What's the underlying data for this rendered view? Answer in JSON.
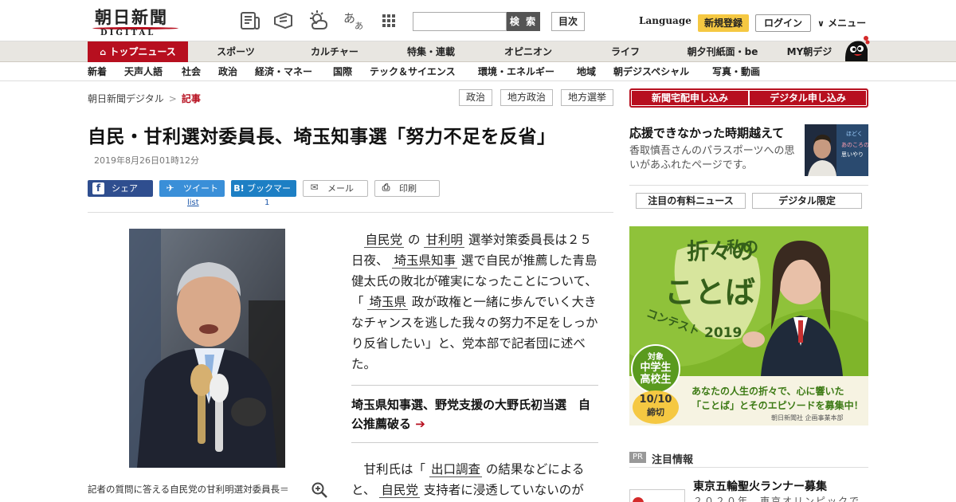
{
  "header": {
    "logo_jp": "朝日新聞",
    "logo_en": "DIGITAL",
    "search_button": "検 索",
    "toc_button": "目次",
    "language": "Language",
    "signup": "新規登録",
    "login": "ログイン",
    "menu": "メニュー"
  },
  "main_nav": [
    "トップニュース",
    "スポーツ",
    "カルチャー",
    "特集・連載",
    "オピニオン",
    "ライフ",
    "朝夕刊紙面・be",
    "MY朝デジ"
  ],
  "sub_nav": [
    "新着",
    "天声人語",
    "社会",
    "政治",
    "経済・マネー",
    "国際",
    "テック＆サイエンス",
    "環境・エネルギー",
    "地域",
    "朝デジスペシャル",
    "写真・動画"
  ],
  "breadcrumb": {
    "home": "朝日新聞デジタル",
    "sep": ">",
    "current": "記事"
  },
  "tags": [
    "政治",
    "地方政治",
    "地方選挙"
  ],
  "article": {
    "headline": "自民・甘利選対委員長、埼玉知事選「努力不足を反省」",
    "date": "2019年8月26日01時12分",
    "share": {
      "facebook": "シェア",
      "twitter": "ツイート",
      "twitter_count": "list",
      "hatena": "ブックマーク",
      "hatena_count": "1",
      "mail": "メール",
      "print": "印刷"
    },
    "caption": "記者の質問に答える自民党の甘利明選対委員長＝",
    "p1": {
      "a": "自民党",
      "b": " の ",
      "c": "甘利明",
      "d": " 選挙対策委員長は２５日夜、 ",
      "e": "埼玉県知事",
      "f": " 選で自民が推薦した青島健太氏の敗北が確実になったことについて、「 ",
      "g": "埼玉県",
      "h": " 政が政権と一緒に歩んでいく大きなチャンスを逃した我々の努力不足をしっかり反省したい」と、党本部で記者団に述べた。"
    },
    "related": "埼玉県知事選、野党支援の大野氏初当選　自公推薦破る",
    "related_arrow": "➔",
    "p2": {
      "a": "甘利氏は「 ",
      "b": "出口調査",
      "c": " の結果などによると、 ",
      "d": "自民党",
      "e": " 支持者に浸透していないのが"
    }
  },
  "sidebar": {
    "subscribe_paper": "新聞宅配申し込み",
    "subscribe_digital": "デジタル申し込み",
    "promo_title": "応援できなかった時期越えて",
    "promo_text": "香取慎吾さんのパラスポーツへの思いがあふれたページです。",
    "tabs": [
      "注目の有料ニュース",
      "デジタル限定"
    ],
    "ad": {
      "watashi": "私の",
      "oriori": "折々の",
      "kotoba": "ことば",
      "contest": "コンテスト",
      "year": "2019",
      "target_label": "対象",
      "target1": "中学生",
      "target2": "高校生",
      "deadline1": "10/10",
      "deadline2": "締切",
      "tagline1": "あなたの人生の折々で、心に響いた",
      "tagline2": "「ことば」とそのエピソードを募集中！",
      "sponsor": "朝日新聞社 企画事業本部"
    },
    "pr_label": "PR",
    "pr_title": "注目情報",
    "pr_item_title": "東京五輪聖火ランナー募集",
    "pr_item_text": "２０２０年、東京オリンピックで"
  },
  "colors": {
    "brand_red": "#b70f1f",
    "signup_yellow": "#f5c842",
    "facebook": "#2f4e8f",
    "twitter": "#3a8fd8",
    "hatena": "#1d7fc4",
    "ad_green": "#7fb52a"
  }
}
